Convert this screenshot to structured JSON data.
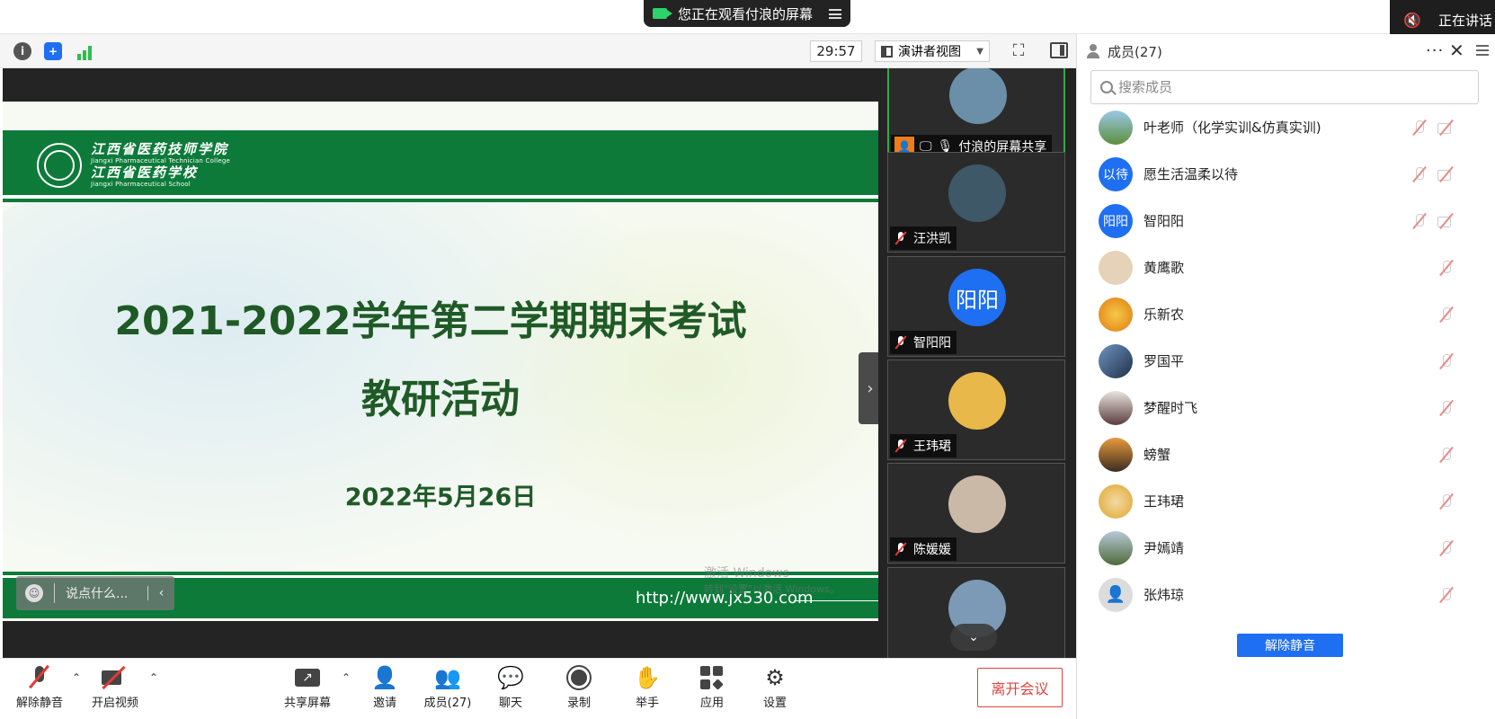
{
  "top": {
    "watching_text": "您正在观看付浪的屏幕",
    "speaking_label": "正在讲话",
    "timer": "29:57",
    "view_mode": "演讲者视图"
  },
  "slide": {
    "school_cn_1": "江西省医药技师学院",
    "school_en_1": "Jiangxi Pharmaceutical Technician College",
    "school_cn_2": "江西省医药学校",
    "school_en_2": "Jiangxi Pharmaceutical School",
    "title_line1": "2021-2022学年第二学期期末考试",
    "title_line2": "教研活动",
    "date": "2022年5月26日",
    "url": "http://www.jx530.com"
  },
  "watermark": {
    "line1": "激活 Windows",
    "line2": "转到\"设置\"以激活 Windows。"
  },
  "chat": {
    "placeholder": "说点什么..."
  },
  "thumbnails": [
    {
      "name": "付浪的屏幕共享",
      "avatar_color": "#6b8fa8",
      "sharing": true
    },
    {
      "name": "汪洪凯",
      "avatar_color": "#3e5868",
      "sharing": false
    },
    {
      "name": "智阳阳",
      "avatar_text": "阳阳",
      "avatar_color": "#1e6ff1",
      "sharing": false
    },
    {
      "name": "王玮珺",
      "avatar_color": "#e8b84a",
      "sharing": false
    },
    {
      "name": "陈媛媛",
      "avatar_color": "#c9b9a6",
      "sharing": false
    }
  ],
  "members_panel": {
    "title": "成员(27)",
    "search_placeholder": "搜索成员",
    "unmute_button": "解除静音",
    "members": [
      {
        "name": "叶老师（化学实训&仿真实训)",
        "avatar_color": "#5d8f3c",
        "video_off": true
      },
      {
        "name": "愿生活温柔以待",
        "avatar_text": "以待",
        "avatar_color": "#1e6ff1",
        "video_off": true
      },
      {
        "name": "智阳阳",
        "avatar_text": "阳阳",
        "avatar_color": "#1e6ff1",
        "video_off": true
      },
      {
        "name": "黄鹰歌",
        "avatar_color": "#e6d2b8",
        "video_off": false
      },
      {
        "name": "乐新农",
        "avatar_color": "#e8a21c",
        "video_off": false
      },
      {
        "name": "罗国平",
        "avatar_color": "#2e4a6b",
        "video_off": false
      },
      {
        "name": "梦醒时飞",
        "avatar_color": "#8a6f63",
        "video_off": false
      },
      {
        "name": "螃蟹",
        "avatar_color": "#b0672a",
        "video_off": false
      },
      {
        "name": "王玮珺",
        "avatar_color": "#e8b84a",
        "video_off": false
      },
      {
        "name": "尹嫣靖",
        "avatar_color": "#5a7a4f",
        "video_off": false
      },
      {
        "name": "张炜琼",
        "avatar_color": "#d0d0d0",
        "video_off": false
      }
    ]
  },
  "toolbar": {
    "unmute": "解除静音",
    "start_video": "开启视频",
    "share_screen": "共享屏幕",
    "invite": "邀请",
    "members": "成员(27)",
    "chat": "聊天",
    "record": "录制",
    "raise_hand": "举手",
    "apps": "应用",
    "settings": "设置",
    "leave": "离开会议"
  }
}
